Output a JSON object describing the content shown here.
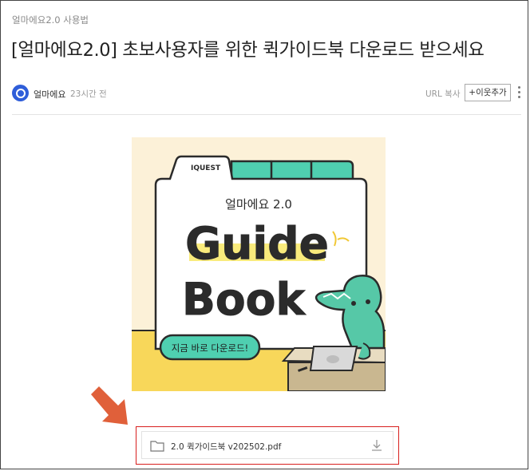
{
  "post": {
    "category": "얼마에요2.0 사용법",
    "title": "[얼마에요2.0] 초보사용자를 위한 퀵가이드북 다운로드 받으세요",
    "author": "얼마에요",
    "time": "23시간 전",
    "url_copy_label": "URL 복사",
    "follow_label": "+이웃추가",
    "more_icon": "more-vertical-icon"
  },
  "banner": {
    "tab_label": "IQUEST",
    "product": "얼마에요 2.0",
    "word1": "Guide",
    "word2": "Book",
    "cta": "지금 바로 다운로드!",
    "colors": {
      "bg": "#fcf1d8",
      "tab": "#4fcfb0",
      "yellow": "#f8d75a",
      "dino": "#56c8a7",
      "highlight": "#f9eb7c"
    }
  },
  "attachment": {
    "file_name": "2.0 퀵가이드북 v202502.pdf",
    "folder_icon": "folder-icon",
    "download_icon": "download-icon",
    "highlight_color": "#d8201e"
  },
  "annotation": {
    "arrow_color": "#e0603a",
    "arrow_icon": "arrow-down-right-icon"
  }
}
